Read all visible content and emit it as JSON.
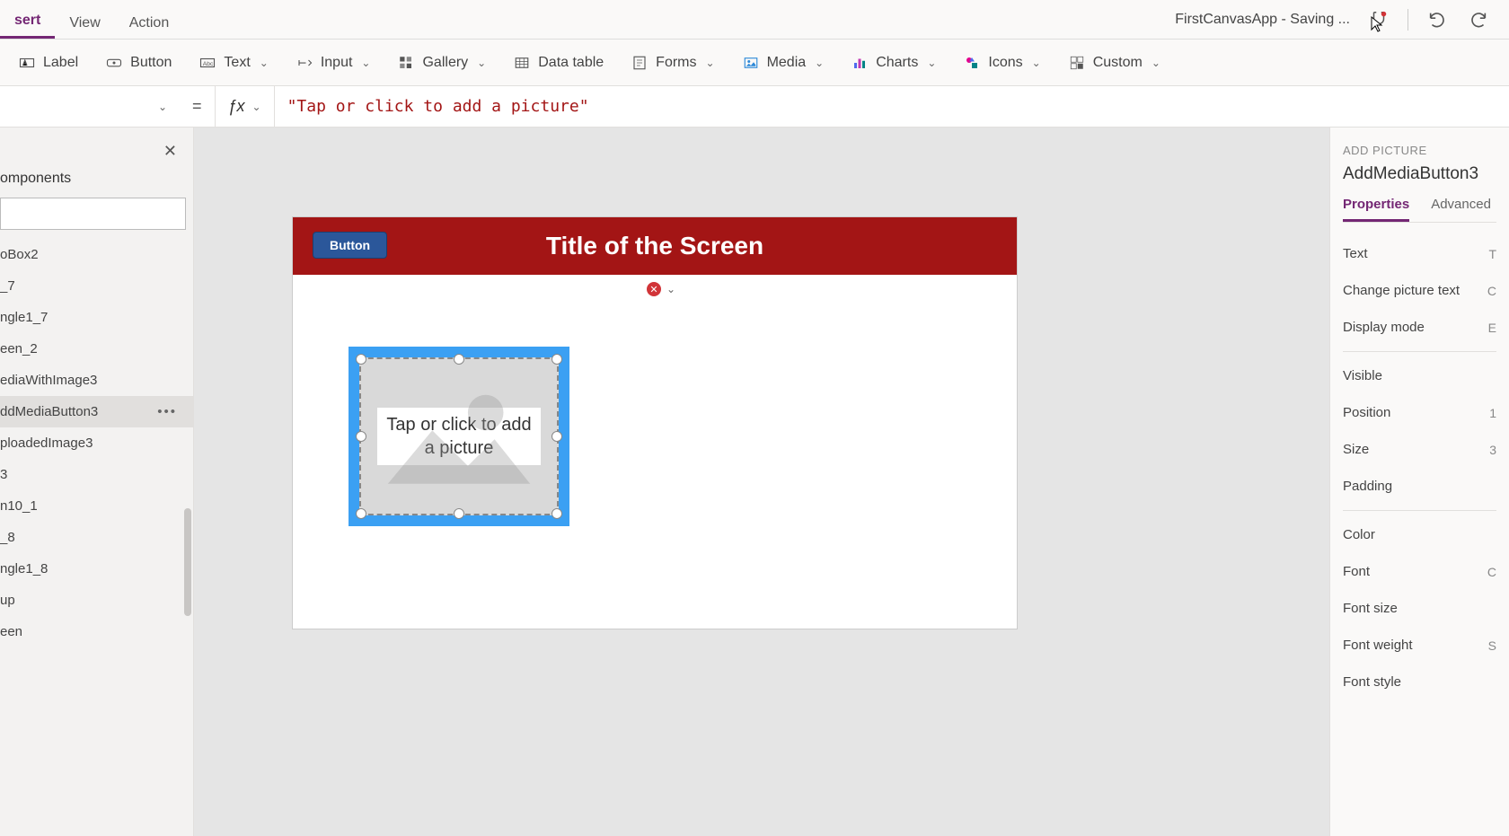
{
  "tabs": {
    "insert": "sert",
    "view": "View",
    "action": "Action"
  },
  "titlebar": {
    "app": "FirstCanvasApp - Saving ..."
  },
  "ribbon": {
    "label": "Label",
    "button": "Button",
    "text": "Text",
    "input": "Input",
    "gallery": "Gallery",
    "datatable": "Data table",
    "forms": "Forms",
    "media": "Media",
    "charts": "Charts",
    "icons": "Icons",
    "custom": "Custom"
  },
  "formula": {
    "value": "\"Tap or click to add a picture\""
  },
  "left": {
    "header": "omponents",
    "items": [
      "oBox2",
      "_7",
      "ngle1_7",
      "een_2",
      "ediaWithImage3",
      "ddMediaButton3",
      "ploadedImage3",
      "3",
      "n10_1",
      "_8",
      "ngle1_8",
      "up",
      "een"
    ],
    "selected_index": 5
  },
  "canvas": {
    "screen_title": "Title of the Screen",
    "button_label": "Button",
    "media_text_l1": "Tap or click to add",
    "media_text_l2": "a picture"
  },
  "right": {
    "category": "ADD PICTURE",
    "name": "AddMediaButton3",
    "tabs": {
      "properties": "Properties",
      "advanced": "Advanced"
    },
    "rows": {
      "text": "Text",
      "text_v": "T",
      "changepic": "Change picture text",
      "changepic_v": "C",
      "display": "Display mode",
      "display_v": "E",
      "visible": "Visible",
      "position": "Position",
      "position_v": "1",
      "size": "Size",
      "size_v": "3",
      "padding": "Padding",
      "color": "Color",
      "font": "Font",
      "font_v": "C",
      "fontsize": "Font size",
      "fontweight": "Font weight",
      "fontweight_v": "S",
      "fontstyle": "Font style"
    }
  }
}
